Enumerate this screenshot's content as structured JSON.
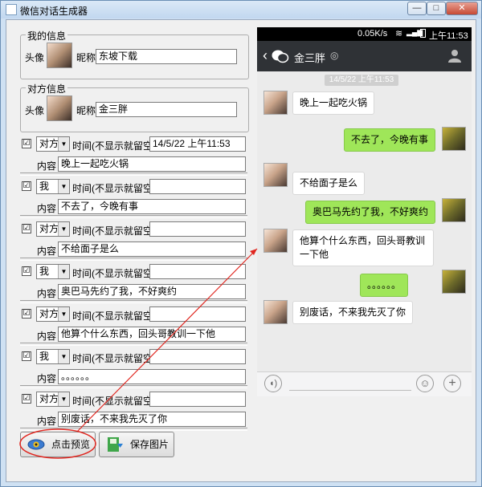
{
  "window": {
    "title": "微信对话生成器",
    "min_label": "—",
    "max_label": "□",
    "close_label": "✕"
  },
  "my_info": {
    "title": "我的信息",
    "avatar_label": "头像",
    "nickname_label": "昵称",
    "nickname": "东坡下载"
  },
  "other_info": {
    "title": "对方信息",
    "avatar_label": "头像",
    "nickname_label": "昵称",
    "nickname": "金三胖"
  },
  "rows": [
    {
      "checked": "☑",
      "sender": "对方",
      "time_label": "时间(不显示就留空)",
      "time": "14/5/22 上午11:53",
      "content_label": "内容",
      "content": "晚上一起吃火锅"
    },
    {
      "checked": "☑",
      "sender": "我",
      "time_label": "时间(不显示就留空)",
      "time": "",
      "content_label": "内容",
      "content": "不去了，今晚有事"
    },
    {
      "checked": "☑",
      "sender": "对方",
      "time_label": "时间(不显示就留空)",
      "time": "",
      "content_label": "内容",
      "content": "不给面子是么"
    },
    {
      "checked": "☑",
      "sender": "我",
      "time_label": "时间(不显示就留空)",
      "time": "",
      "content_label": "内容",
      "content": "奥巴马先约了我，不好爽约"
    },
    {
      "checked": "☑",
      "sender": "对方",
      "time_label": "时间(不显示就留空)",
      "time": "",
      "content_label": "内容",
      "content": "他算个什么东西，回头哥教训一下他"
    },
    {
      "checked": "☑",
      "sender": "我",
      "time_label": "时间(不显示就留空)",
      "time": "",
      "content_label": "内容",
      "content": "。。。。。。"
    },
    {
      "checked": "☑",
      "sender": "对方",
      "time_label": "时间(不显示就留空)",
      "time": "",
      "content_label": "内容",
      "content": "别废话，不来我先灭了你"
    }
  ],
  "buttons": {
    "preview": "点击预览",
    "save": "保存图片"
  },
  "phone": {
    "status": {
      "speed": "0.05K/s",
      "time": "上午11:53"
    },
    "nav": {
      "back": "‹",
      "name": "金三胖"
    },
    "timestamp": "14/5/22 上午11:53",
    "messages": [
      {
        "side": "left",
        "text": "晚上一起吃火锅"
      },
      {
        "side": "right",
        "text": "不去了，今晚有事"
      },
      {
        "side": "left",
        "text": "不给面子是么"
      },
      {
        "side": "right",
        "text": "奥巴马先约了我，不好爽约"
      },
      {
        "side": "left",
        "text": "他算个什么东西，回头哥教训一下他"
      },
      {
        "side": "right",
        "text": "。。。。。。"
      },
      {
        "side": "left",
        "text": "别废话，不来我先灭了你"
      }
    ]
  },
  "colors": {
    "bubble_right": "#9fe659",
    "bubble_left": "#ffffff",
    "nav_bg": "#2f3236",
    "annotation": "#e0261f"
  }
}
